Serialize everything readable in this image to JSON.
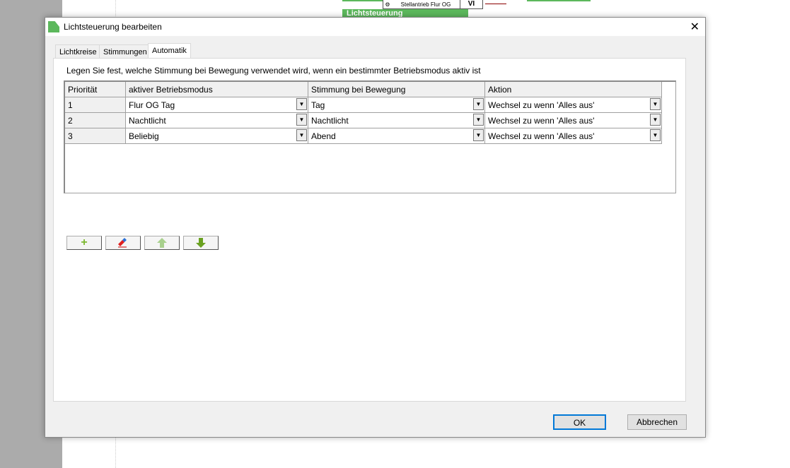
{
  "background": {
    "node_label": "Stellantrieb Flur OG",
    "node_port": "VI",
    "block_title": "Lichtsteuerung"
  },
  "dialog": {
    "title": "Lichtsteuerung bearbeiten",
    "tabs": [
      {
        "label": "Lichtkreise"
      },
      {
        "label": "Stimmungen"
      },
      {
        "label": "Automatik",
        "active": true
      }
    ],
    "instruction": "Legen Sie fest, welche Stimmung bei Bewegung verwendet wird, wenn ein bestimmter Betriebsmodus aktiv ist",
    "table": {
      "headers": [
        "Priorität",
        "aktiver Betriebsmodus",
        "Stimmung bei Bewegung",
        "Aktion"
      ],
      "rows": [
        [
          "1",
          "Flur OG Tag",
          "Tag",
          "Wechsel zu wenn 'Alles aus'"
        ],
        [
          "2",
          "Nachtlicht",
          "Nachtlicht",
          "Wechsel zu wenn 'Alles aus'"
        ],
        [
          "3",
          "Beliebig",
          "Abend",
          "Wechsel zu wenn 'Alles aus'"
        ]
      ]
    },
    "buttons": {
      "ok": "OK",
      "cancel": "Abbrechen"
    },
    "colors": {
      "add": "#7cb82f",
      "up": "#a8d08d",
      "down": "#6aa121",
      "accent": "#0078d7"
    }
  }
}
